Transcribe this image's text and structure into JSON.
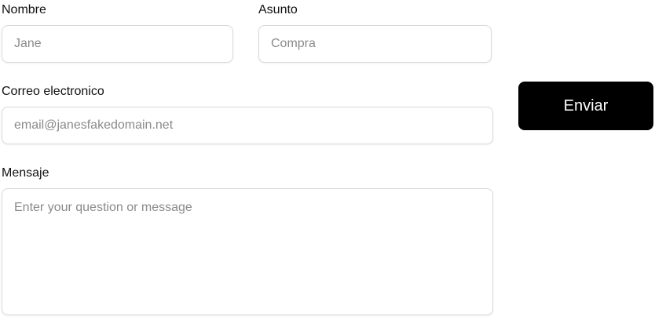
{
  "form": {
    "name": {
      "label": "Nombre",
      "placeholder": "Jane",
      "value": ""
    },
    "subject": {
      "label": "Asunto",
      "placeholder": "Compra",
      "value": ""
    },
    "email": {
      "label": "Correo electronico",
      "placeholder": "email@janesfakedomain.net",
      "value": ""
    },
    "message": {
      "label": "Mensaje",
      "placeholder": "Enter your question or message",
      "value": ""
    },
    "submit_label": "Enviar"
  },
  "colors": {
    "button_background": "#000000",
    "button_text": "#ffffff",
    "field_border": "#d9d9d9",
    "placeholder": "#8a8a8a"
  }
}
